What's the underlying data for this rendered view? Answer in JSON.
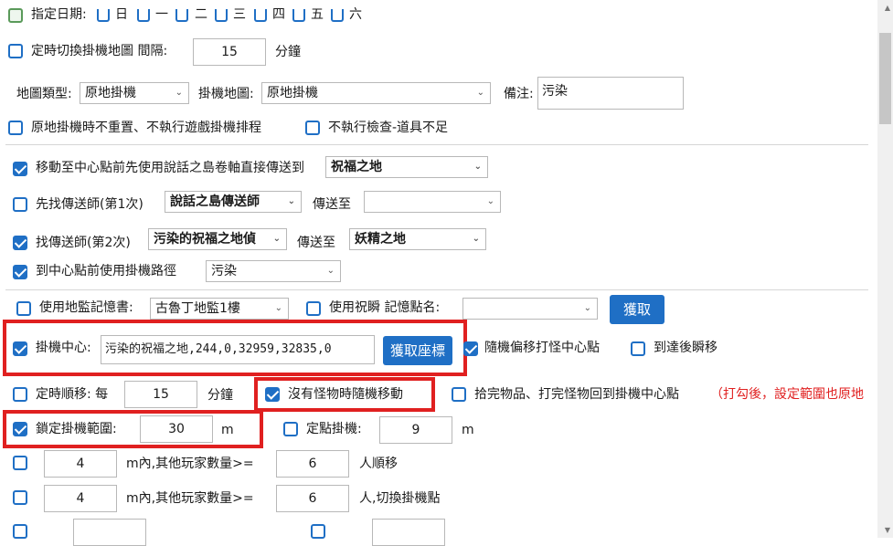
{
  "row_days": {
    "label": "指定日期:",
    "days": [
      "日",
      "一",
      "二",
      "三",
      "四",
      "五",
      "六"
    ]
  },
  "row_switch": {
    "label": "定時切換掛機地圖 間隔:",
    "value": "15",
    "unit": "分鐘"
  },
  "row_map": {
    "map_type_label": "地圖類型:",
    "map_type_value": "原地掛機",
    "hang_map_label": "掛機地圖:",
    "hang_map_value": "原地掛機",
    "note_label": "備注:",
    "note_value": "污染"
  },
  "row_options": {
    "no_reset": "原地掛機時不重置、不執行遊戲掛機排程",
    "no_check": "不執行檢查-道具不足"
  },
  "row_teleport_scroll": {
    "label": "移動至中心點前先使用說話之島卷軸直接傳送到",
    "value": "祝福之地"
  },
  "row_teleporter1": {
    "label": "先找傳送師(第1次)",
    "npc_value": "說話之島傳送師",
    "to_label": "傳送至",
    "to_value": ""
  },
  "row_teleporter2": {
    "label": "找傳送師(第2次)",
    "npc_value": "污染的祝福之地偵",
    "to_label": "傳送至",
    "to_value": "妖精之地"
  },
  "row_path": {
    "label": "到中心點前使用掛機路徑",
    "value": "污染"
  },
  "row_memory": {
    "label": "使用地監記憶書:",
    "book_value": "古魯丁地監1樓",
    "bless_label": "使用祝瞬 記憶點名:",
    "bless_value": "",
    "fetch_button": "獲取"
  },
  "row_center": {
    "label": "掛機中心:",
    "value": "污染的祝福之地,244,0,32959,32835,0",
    "fetch_coords_button": "獲取座標",
    "random_offset": "隨機偏移打怪中心點",
    "arrive_teleport": "到達後瞬移"
  },
  "row_timed": {
    "label": "定時順移: 每",
    "value": "15",
    "unit": "分鐘",
    "random_move": "沒有怪物時隨機移動",
    "return_center": "拾完物品、打完怪物回到掛機中心點",
    "note": "（打勾後，設定範圍也原地"
  },
  "row_lock": {
    "label": "鎖定掛機範圍:",
    "value": "30",
    "unit": "m",
    "fixed_label": "定點掛機:",
    "fixed_value": "9",
    "fixed_unit": "m"
  },
  "row_players1": {
    "dist": "4",
    "mid": "m內,其他玩家數量>=",
    "count": "6",
    "tail": "人順移"
  },
  "row_players2": {
    "dist": "4",
    "mid": "m內,其他玩家數量>=",
    "count": "6",
    "tail": "人,切換掛機點"
  },
  "colors": {
    "accent": "#1f6fc5",
    "highlight": "#e02020"
  }
}
